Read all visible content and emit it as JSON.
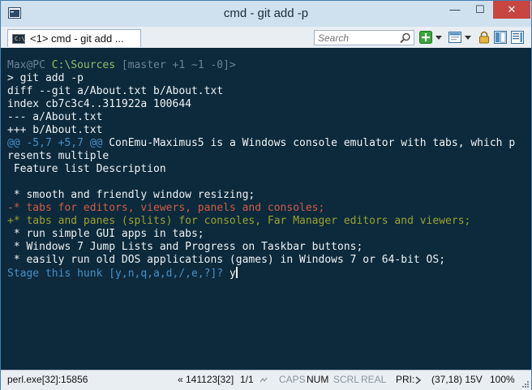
{
  "window": {
    "title": "cmd - git  add -p"
  },
  "titlebar": {
    "min_glyph": "—",
    "max_glyph": "☐",
    "close_glyph": "✕"
  },
  "tab": {
    "label": "<1> cmd - git  add ...",
    "icon_text": "C:\\_"
  },
  "search": {
    "placeholder": "Search"
  },
  "toolbar": {
    "icons": [
      "add-icon",
      "dropdown-icon",
      "layout-icon",
      "dropdown-icon",
      "lock-icon",
      "pane-icon",
      "scroll-icon"
    ]
  },
  "terminal": {
    "prompt_user": "Max@PC",
    "prompt_path": "C:\\Sources",
    "prompt_branch": "[master +1 ~1 -0]>",
    "lines": [
      "> git add -p",
      "diff --git a/About.txt b/About.txt",
      "index cb7c3c4..311922a 100644",
      "--- a/About.txt",
      "+++ b/About.txt"
    ],
    "hunk_header": "@@ -5,7 +5,7 @@",
    "hunk_text_1": " ConEmu-Maximus5 is a Windows console emulator with tabs, which p",
    "hunk_text_2": "resents multiple",
    "context_1": " Feature list Description",
    "context_2": "",
    "context_3": " * smooth and friendly window resizing;",
    "removed": "-* tabs for editors, viewers, panels and consoles;",
    "added": "+* tabs and panes (splits) for consoles, Far Manager editors and viewers;",
    "context_4": " * run simple GUI apps in tabs;",
    "context_5": " * Windows 7 Jump Lists and Progress on Taskbar buttons;",
    "context_6": " * easily run old DOS applications (games) in Windows 7 or 64-bit OS;",
    "stage_prompt": "Stage this hunk [y,n,q,a,d,/,e,?]? ",
    "input": "y"
  },
  "statusbar": {
    "process": "perl.exe[32]:15856",
    "console_size": "« 141123[32]",
    "tab_count": "1/1",
    "caps": "CAPS",
    "num": "NUM",
    "scrl": "SCRL",
    "mode": "REAL",
    "priority": "PRI:",
    "cursor_pos": "(37,18) 15V",
    "zoom": "100%"
  },
  "colors": {
    "terminal_bg": "#0c2a3c",
    "removed": "#cf5b43",
    "added": "#9aa22e",
    "prompt": "#4c8fc4",
    "close_button": "#c7463f"
  }
}
